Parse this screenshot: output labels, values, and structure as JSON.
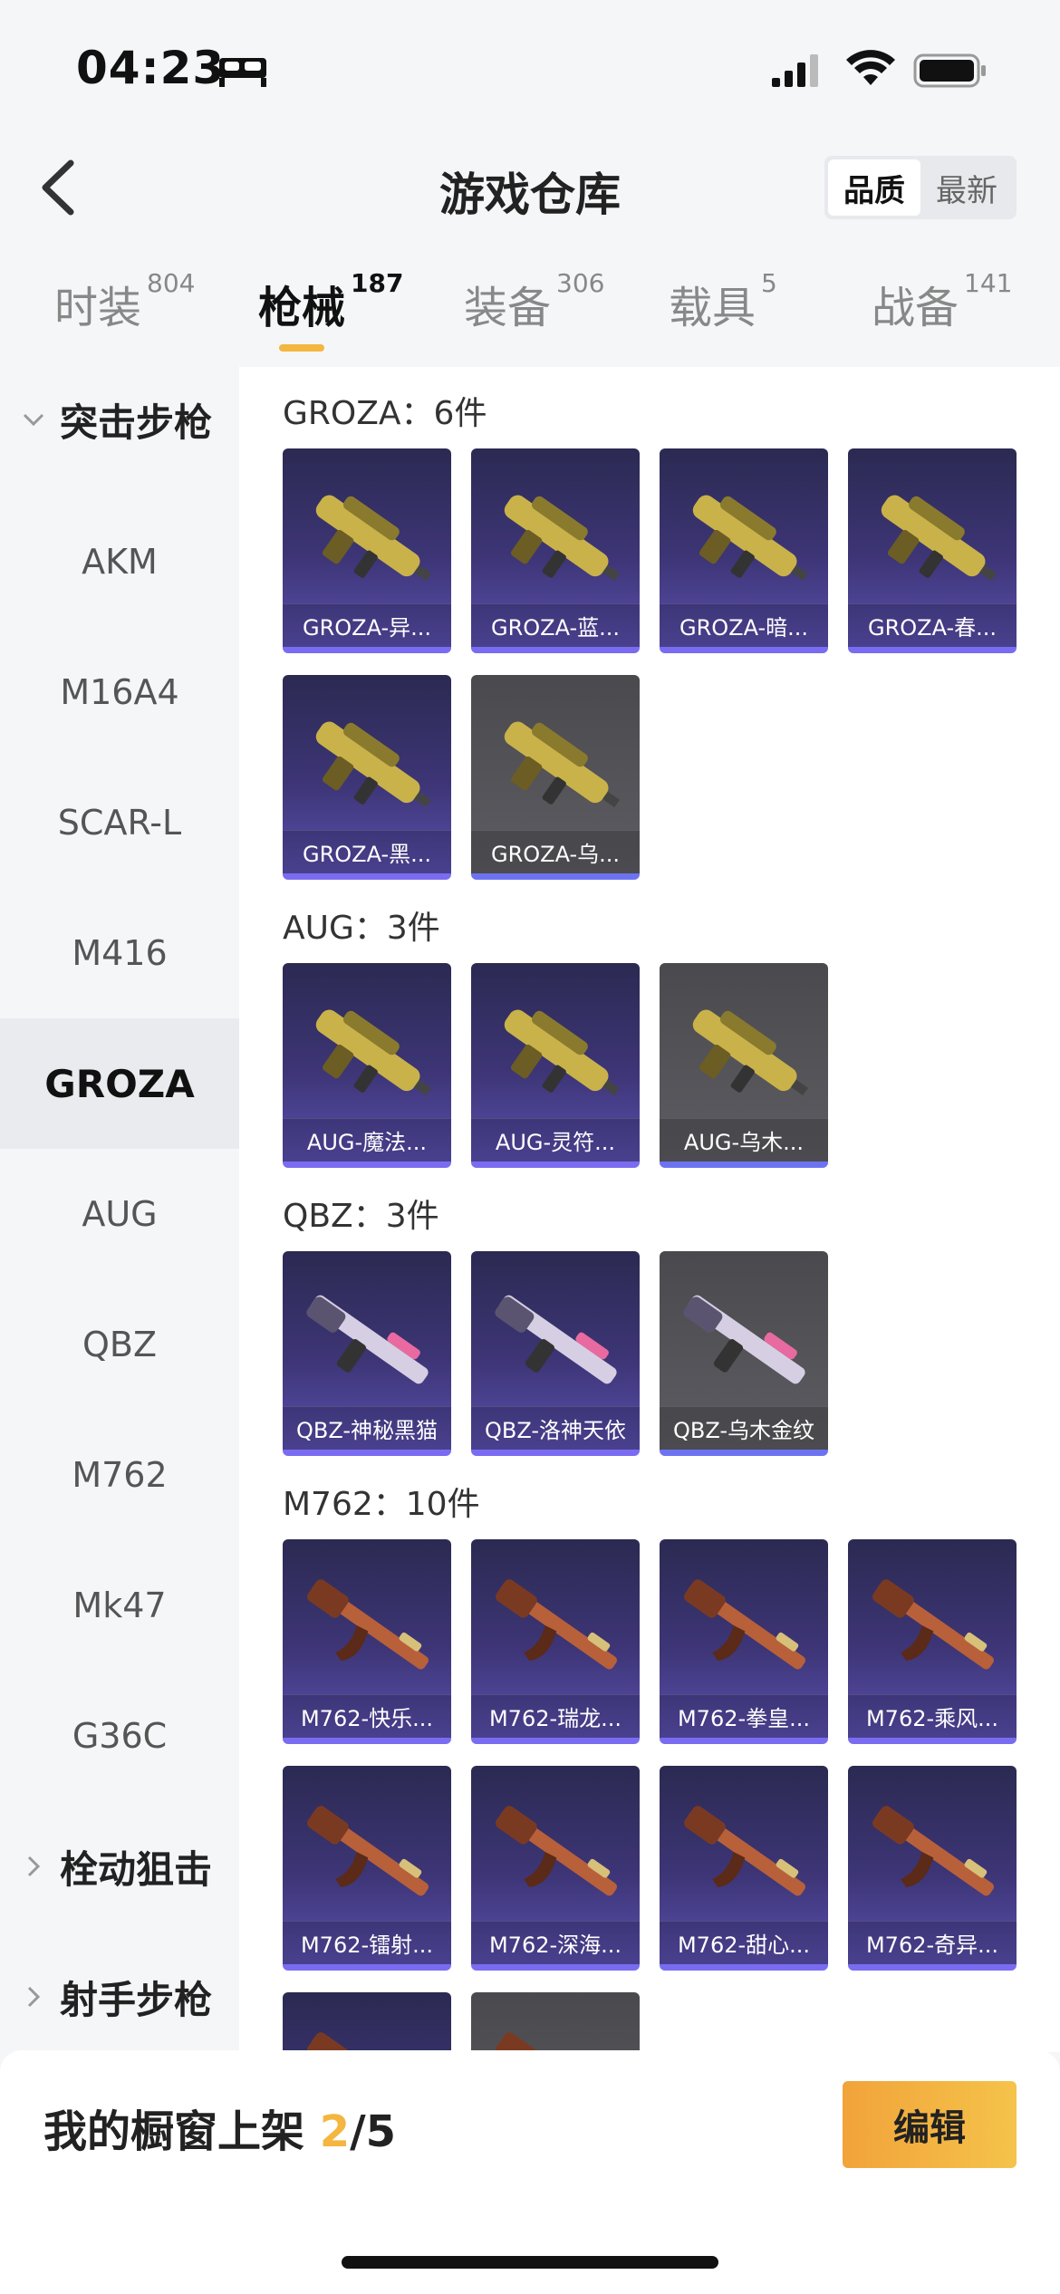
{
  "status": {
    "time": "04:23"
  },
  "header": {
    "title": "游戏仓库",
    "sort_quality": "品质",
    "sort_newest": "最新"
  },
  "tabs": [
    {
      "label": "时装",
      "count": "804"
    },
    {
      "label": "枪械",
      "count": "187"
    },
    {
      "label": "装备",
      "count": "306"
    },
    {
      "label": "载具",
      "count": "5"
    },
    {
      "label": "战备",
      "count": "141"
    }
  ],
  "sidebar": {
    "group_assault": "突击步枪",
    "items": [
      "AKM",
      "M16A4",
      "SCAR-L",
      "M416",
      "GROZA",
      "AUG",
      "QBZ",
      "M762",
      "Mk47",
      "G36C"
    ],
    "group_bolt": "栓动狙击",
    "group_marksman": "射手步枪"
  },
  "sections": [
    {
      "title": "GROZA：6件",
      "cards": [
        "GROZA-异...",
        "GROZA-蓝...",
        "GROZA-暗...",
        "GROZA-春...",
        "GROZA-黑...",
        "GROZA-乌..."
      ]
    },
    {
      "title": "AUG：3件",
      "cards": [
        "AUG-魔法...",
        "AUG-灵符...",
        "AUG-乌木..."
      ]
    },
    {
      "title": "QBZ：3件",
      "cards": [
        "QBZ-神秘黑猫",
        "QBZ-洛神天依",
        "QBZ-乌木金纹"
      ]
    },
    {
      "title": "M762：10件",
      "cards": [
        "M762-快乐...",
        "M762-瑞龙...",
        "M762-拳皇...",
        "M762-乘风...",
        "M762-镭射...",
        "M762-深海...",
        "M762-甜心...",
        "M762-奇异..."
      ]
    }
  ],
  "bottom": {
    "shelf_label": "我的橱窗上架",
    "shelf_current": "2",
    "shelf_total": "/5",
    "edit_button": "编辑"
  },
  "colors": {
    "accent": "#f4b640",
    "card_purple": "#3d3576",
    "card_grey": "#5c5c62"
  }
}
